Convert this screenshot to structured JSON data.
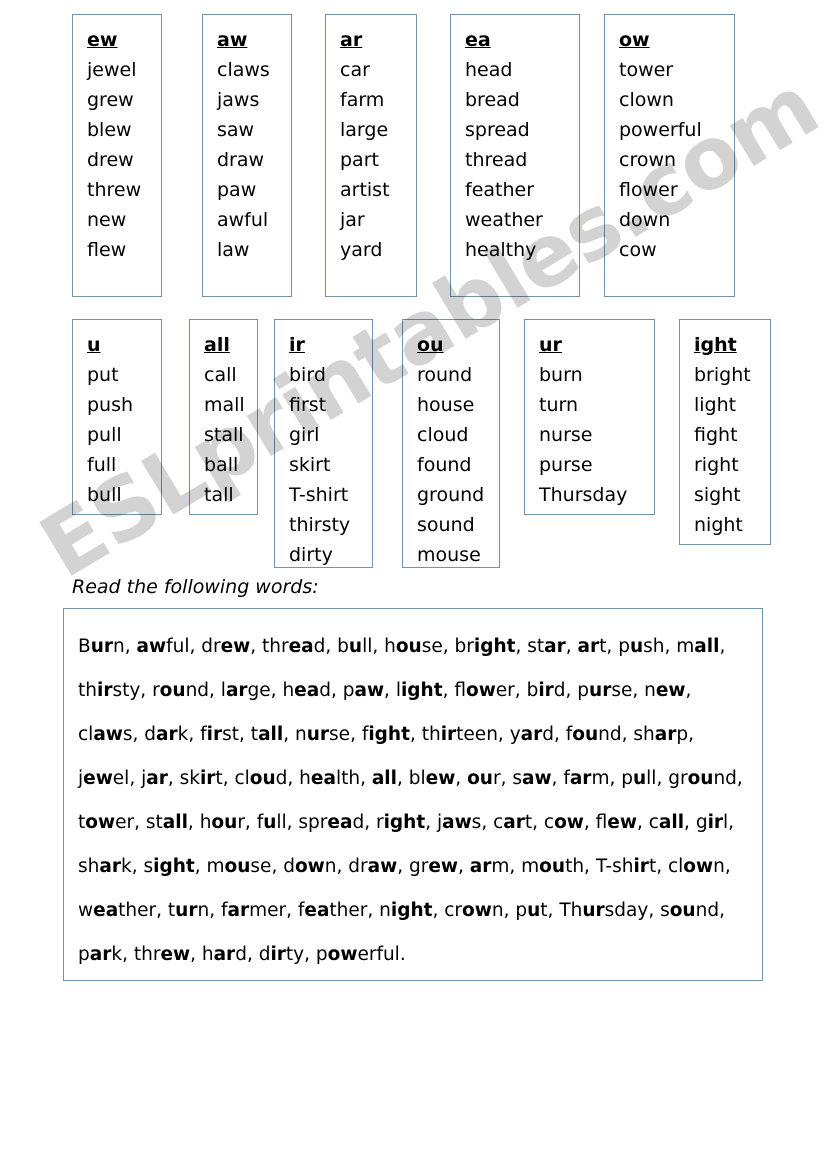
{
  "worksheet": {
    "instruction": "Read the following words:",
    "watermark": "ESLprintables.com",
    "border_color": "#7593a8"
  },
  "phonogram_boxes": [
    {
      "id": "ew",
      "heading": "ew",
      "words": [
        "jewel",
        "grew",
        "blew",
        "drew",
        "threw",
        "new",
        "flew"
      ]
    },
    {
      "id": "aw",
      "heading": "aw",
      "words": [
        "claws",
        "jaws",
        "saw",
        "draw",
        "paw",
        "awful",
        "law"
      ]
    },
    {
      "id": "ar",
      "heading": "ar",
      "words": [
        "car",
        "farm",
        "large",
        "part",
        "artist",
        "jar",
        "yard"
      ]
    },
    {
      "id": "ea",
      "heading": "ea",
      "words": [
        "head",
        "bread",
        "spread",
        "thread",
        "feather",
        "weather",
        "healthy"
      ]
    },
    {
      "id": "ow",
      "heading": "ow",
      "words": [
        "tower",
        "clown",
        "powerful",
        "crown",
        "flower",
        "down",
        "cow"
      ]
    },
    {
      "id": "u",
      "heading": "u",
      "words": [
        "put",
        "push",
        "pull",
        "full",
        "bull"
      ]
    },
    {
      "id": "all",
      "heading": "all",
      "words": [
        "call",
        "mall",
        "stall",
        "ball",
        "tall"
      ]
    },
    {
      "id": "ir",
      "heading": "ir",
      "words": [
        "bird",
        "first",
        "girl",
        "skirt",
        "T-shirt",
        "thirsty",
        "dirty"
      ]
    },
    {
      "id": "ou",
      "heading": "ou",
      "words": [
        "round",
        "house",
        "cloud",
        "found",
        "ground",
        "sound",
        "mouse"
      ]
    },
    {
      "id": "ur",
      "heading": "ur",
      "words": [
        "burn",
        "turn",
        "nurse",
        "purse",
        "Thursday"
      ]
    },
    {
      "id": "ight",
      "heading": "ight",
      "words": [
        "bright",
        "light",
        "fight",
        "right",
        "sight",
        "night"
      ]
    }
  ],
  "reading_list": {
    "words": [
      {
        "pre": "B",
        "bold": "ur",
        "post": "n"
      },
      {
        "pre": "",
        "bold": "aw",
        "post": "ful"
      },
      {
        "pre": "dr",
        "bold": "ew",
        "post": ""
      },
      {
        "pre": "thr",
        "bold": "ea",
        "post": "d"
      },
      {
        "pre": "b",
        "bold": "u",
        "post": "ll"
      },
      {
        "pre": "h",
        "bold": "ou",
        "post": "se"
      },
      {
        "pre": "br",
        "bold": "ight",
        "post": ""
      },
      {
        "pre": "st",
        "bold": "ar",
        "post": ""
      },
      {
        "pre": "",
        "bold": "ar",
        "post": "t"
      },
      {
        "pre": "p",
        "bold": "u",
        "post": "sh"
      },
      {
        "pre": "m",
        "bold": "all",
        "post": ""
      },
      {
        "pre": "th",
        "bold": "ir",
        "post": "sty"
      },
      {
        "pre": "r",
        "bold": "ou",
        "post": "nd"
      },
      {
        "pre": "l",
        "bold": "ar",
        "post": "ge"
      },
      {
        "pre": "h",
        "bold": "ea",
        "post": "d"
      },
      {
        "pre": "p",
        "bold": "aw",
        "post": ""
      },
      {
        "pre": "l",
        "bold": "ight",
        "post": ""
      },
      {
        "pre": "fl",
        "bold": "ow",
        "post": "er"
      },
      {
        "pre": "b",
        "bold": "ir",
        "post": "d"
      },
      {
        "pre": "p",
        "bold": "ur",
        "post": "se"
      },
      {
        "pre": "n",
        "bold": "ew",
        "post": ""
      },
      {
        "pre": "cl",
        "bold": "aw",
        "post": "s"
      },
      {
        "pre": "d",
        "bold": "ar",
        "post": "k"
      },
      {
        "pre": "f",
        "bold": "ir",
        "post": "st"
      },
      {
        "pre": "t",
        "bold": "all",
        "post": ""
      },
      {
        "pre": "n",
        "bold": "ur",
        "post": "se"
      },
      {
        "pre": "f",
        "bold": "ight",
        "post": ""
      },
      {
        "pre": "th",
        "bold": "ir",
        "post": "teen"
      },
      {
        "pre": "y",
        "bold": "ar",
        "post": "d"
      },
      {
        "pre": "f",
        "bold": "ou",
        "post": "nd"
      },
      {
        "pre": "sh",
        "bold": "ar",
        "post": "p"
      },
      {
        "pre": "j",
        "bold": "ew",
        "post": "el"
      },
      {
        "pre": "j",
        "bold": "ar",
        "post": ""
      },
      {
        "pre": "sk",
        "bold": "ir",
        "post": "t"
      },
      {
        "pre": "cl",
        "bold": "ou",
        "post": "d"
      },
      {
        "pre": "h",
        "bold": "ea",
        "post": "lth"
      },
      {
        "pre": "",
        "bold": "all",
        "post": ""
      },
      {
        "pre": "bl",
        "bold": "ew",
        "post": ""
      },
      {
        "pre": "",
        "bold": "ou",
        "post": "r"
      },
      {
        "pre": "s",
        "bold": "aw",
        "post": ""
      },
      {
        "pre": "f",
        "bold": "ar",
        "post": "m"
      },
      {
        "pre": "p",
        "bold": "u",
        "post": "ll"
      },
      {
        "pre": "gr",
        "bold": "ou",
        "post": "nd"
      },
      {
        "pre": "t",
        "bold": "ow",
        "post": "er"
      },
      {
        "pre": "st",
        "bold": "all",
        "post": ""
      },
      {
        "pre": "h",
        "bold": "ou",
        "post": "r"
      },
      {
        "pre": "f",
        "bold": "u",
        "post": "ll"
      },
      {
        "pre": "spr",
        "bold": "ea",
        "post": "d"
      },
      {
        "pre": "r",
        "bold": "ight",
        "post": ""
      },
      {
        "pre": "j",
        "bold": "aw",
        "post": "s"
      },
      {
        "pre": "c",
        "bold": "ar",
        "post": "t"
      },
      {
        "pre": "c",
        "bold": "ow",
        "post": ""
      },
      {
        "pre": "fl",
        "bold": "ew",
        "post": ""
      },
      {
        "pre": "c",
        "bold": "all",
        "post": ""
      },
      {
        "pre": "g",
        "bold": "ir",
        "post": "l"
      },
      {
        "pre": "sh",
        "bold": "ar",
        "post": "k"
      },
      {
        "pre": "s",
        "bold": "ight",
        "post": ""
      },
      {
        "pre": "m",
        "bold": "ou",
        "post": "se"
      },
      {
        "pre": "d",
        "bold": "ow",
        "post": "n"
      },
      {
        "pre": "dr",
        "bold": "aw",
        "post": ""
      },
      {
        "pre": "gr",
        "bold": "ew",
        "post": ""
      },
      {
        "pre": "",
        "bold": "ar",
        "post": "m"
      },
      {
        "pre": "m",
        "bold": "ou",
        "post": "th"
      },
      {
        "pre": "T-sh",
        "bold": "ir",
        "post": "t"
      },
      {
        "pre": "cl",
        "bold": "ow",
        "post": "n"
      },
      {
        "pre": "w",
        "bold": "ea",
        "post": "ther"
      },
      {
        "pre": "t",
        "bold": "ur",
        "post": "n"
      },
      {
        "pre": "f",
        "bold": "ar",
        "post": "mer"
      },
      {
        "pre": "f",
        "bold": "ea",
        "post": "ther"
      },
      {
        "pre": "n",
        "bold": "ight",
        "post": ""
      },
      {
        "pre": "cr",
        "bold": "ow",
        "post": "n"
      },
      {
        "pre": "p",
        "bold": "u",
        "post": "t"
      },
      {
        "pre": "Th",
        "bold": "ur",
        "post": "sday"
      },
      {
        "pre": "s",
        "bold": "ou",
        "post": "nd"
      },
      {
        "pre": "p",
        "bold": "ar",
        "post": "k"
      },
      {
        "pre": "thr",
        "bold": "ew",
        "post": ""
      },
      {
        "pre": "h",
        "bold": "ar",
        "post": "d"
      },
      {
        "pre": "d",
        "bold": "ir",
        "post": "ty"
      },
      {
        "pre": "p",
        "bold": "ow",
        "post": "erful."
      }
    ]
  }
}
